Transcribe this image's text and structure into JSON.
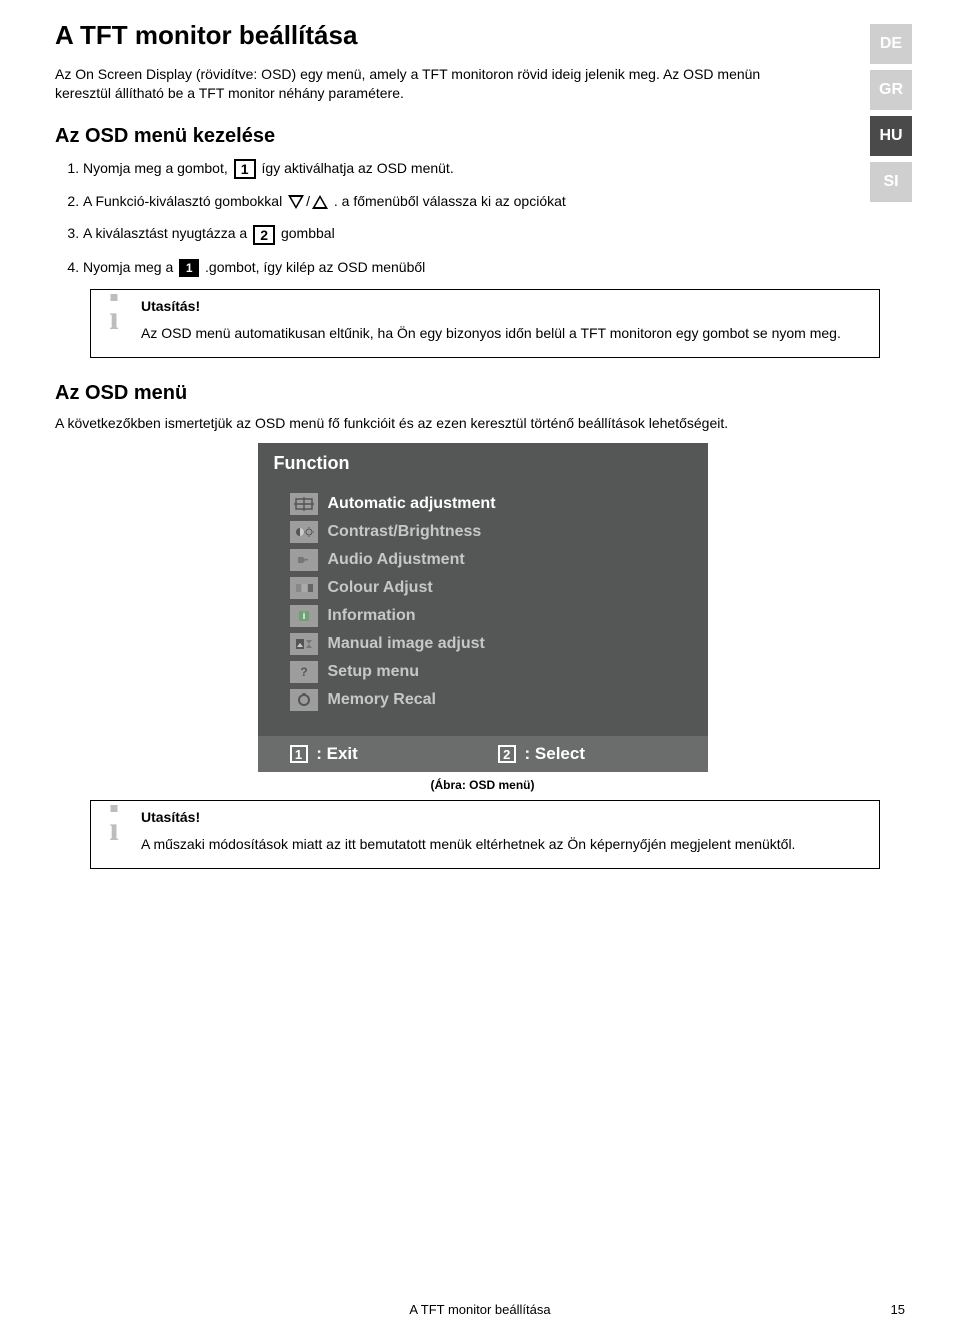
{
  "lang_tabs": [
    "DE",
    "GR",
    "HU",
    "SI"
  ],
  "active_lang_index": 2,
  "title": "A TFT monitor beállítása",
  "intro": "Az On Screen Display (rövidítve: OSD) egy menü, amely a TFT monitoron rövid ideig jelenik meg. Az OSD menün keresztül állítható be a TFT monitor néhány paramétere.",
  "section1_title": "Az OSD menü kezelése",
  "steps": {
    "s1a": "Nyomja meg a gombot, ",
    "s1b": " így aktiválhatja az OSD menüt.",
    "s2a": "A Funkció-kiválasztó gombokkal ",
    "s2b": ". a főmenüből válassza ki az opciókat",
    "s3a": "A kiválasztást nyugtázza a ",
    "s3b": " gombbal",
    "s4a": "Nyomja meg a ",
    "s4b": ".gombot, így  kilép az OSD menüből"
  },
  "icon_labels": {
    "one": "1",
    "two": "2"
  },
  "note1": {
    "title": "Utasítás!",
    "text": "Az OSD menü automatikusan eltűnik, ha Ön egy bizonyos időn belül a TFT monitoron egy gombot se nyom meg."
  },
  "section2_title": "Az OSD menü",
  "section2_desc": "A következőkben ismertetjük az OSD menü fő funkcióit és az ezen keresztül történő beállítások lehetőségeit.",
  "osd": {
    "header": "Function",
    "items": [
      "Automatic adjustment",
      "Contrast/Brightness",
      "Audio Adjustment",
      "Colour Adjust",
      "Information",
      "Manual image adjust",
      "Setup menu",
      "Memory Recal"
    ],
    "footer_exit": ": Exit",
    "footer_select": ": Select"
  },
  "caption": "(Ábra: OSD menü)",
  "note2": {
    "title": "Utasítás!",
    "text": "A műszaki módosítások miatt az itt bemutatott menük eltérhetnek az Ön képernyőjén megjelent menüktől."
  },
  "footer_text": "A TFT monitor beállítása",
  "page_number": "15"
}
